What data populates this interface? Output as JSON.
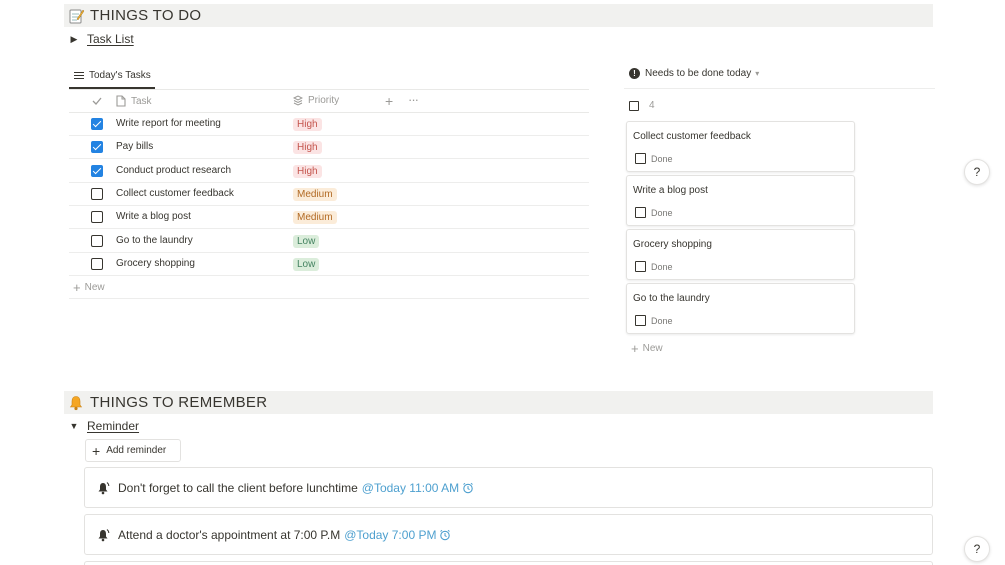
{
  "sections": {
    "todo": {
      "title": "THINGS TO DO",
      "emoji_icon": "memo-icon"
    },
    "remember": {
      "title": "THINGS TO REMEMBER",
      "emoji_icon": "bell-icon"
    }
  },
  "task_list_toggle": {
    "label": "Task List",
    "state": "collapsed"
  },
  "table": {
    "view_tab": "Today's Tasks",
    "columns": {
      "task": "Task",
      "priority": "Priority"
    },
    "rows": [
      {
        "checked": true,
        "task": "Write report for meeting",
        "priority": "High"
      },
      {
        "checked": true,
        "task": "Pay bills",
        "priority": "High"
      },
      {
        "checked": true,
        "task": "Conduct product research",
        "priority": "High"
      },
      {
        "checked": false,
        "task": "Collect customer feedback",
        "priority": "Medium"
      },
      {
        "checked": false,
        "task": "Write a blog post",
        "priority": "Medium"
      },
      {
        "checked": false,
        "task": "Go to the laundry",
        "priority": "Low"
      },
      {
        "checked": false,
        "task": "Grocery shopping",
        "priority": "Low"
      }
    ],
    "new_label": "New"
  },
  "priority_colors": {
    "High": {
      "bg": "#fbe4e4",
      "fg": "#c4554d"
    },
    "Medium": {
      "bg": "#fbecd9",
      "fg": "#b26a24"
    },
    "Low": {
      "bg": "#dbeddb",
      "fg": "#448361"
    }
  },
  "board": {
    "title": "Needs to be done today",
    "count": "4",
    "cards": [
      {
        "title": "Collect customer feedback",
        "done_label": "Done"
      },
      {
        "title": "Write a blog post",
        "done_label": "Done"
      },
      {
        "title": "Grocery shopping",
        "done_label": "Done"
      },
      {
        "title": "Go to the laundry",
        "done_label": "Done"
      }
    ],
    "new_label": "New"
  },
  "reminder_toggle": {
    "label": "Reminder",
    "state": "expanded"
  },
  "add_reminder_label": "Add reminder",
  "reminders": [
    {
      "text": "Don't forget to call the client before lunchtime",
      "mention": "@Today 11:00 AM"
    },
    {
      "text": "Attend a doctor's appointment at 7:00 P.M",
      "mention": "@Today 7:00 PM"
    }
  ],
  "help_label": "?",
  "colors": {
    "accent": "#2383e2",
    "mention": "#4ea0cf",
    "section_bg": "#f1f1ef"
  }
}
